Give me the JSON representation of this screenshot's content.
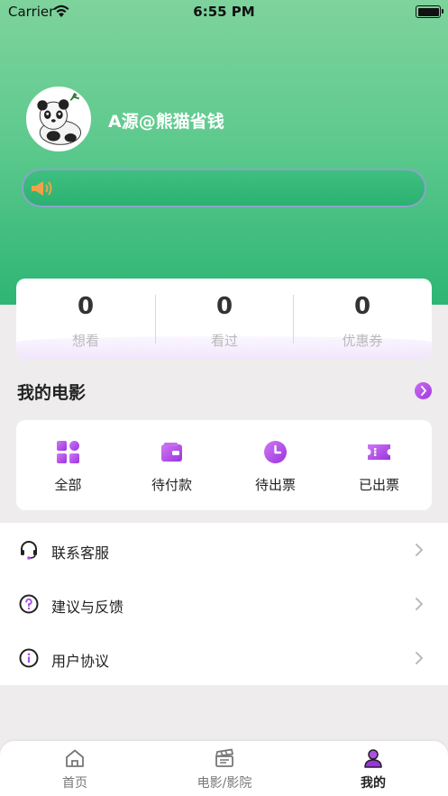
{
  "status_bar": {
    "carrier": "Carrier",
    "time": "6:55 PM"
  },
  "profile": {
    "username": "A源@熊猫省钱"
  },
  "stats": [
    {
      "value": "0",
      "label": "想看"
    },
    {
      "value": "0",
      "label": "看过"
    },
    {
      "value": "0",
      "label": "优惠券"
    }
  ],
  "my_movies": {
    "title": "我的电影",
    "items": [
      {
        "label": "全部",
        "icon": "grid-icon"
      },
      {
        "label": "待付款",
        "icon": "wallet-icon"
      },
      {
        "label": "待出票",
        "icon": "clock-icon"
      },
      {
        "label": "已出票",
        "icon": "ticket-icon"
      }
    ]
  },
  "menu": [
    {
      "label": "联系客服",
      "icon": "headset-icon"
    },
    {
      "label": "建议与反馈",
      "icon": "question-icon"
    },
    {
      "label": "用户协议",
      "icon": "info-icon"
    }
  ],
  "tabs": [
    {
      "label": "首页",
      "icon": "home-icon"
    },
    {
      "label": "电影/影院",
      "icon": "clapperboard-icon"
    },
    {
      "label": "我的",
      "icon": "user-icon",
      "active": true
    }
  ],
  "colors": {
    "header_green": "#2eb574",
    "accent_purple": "#a546e6"
  }
}
